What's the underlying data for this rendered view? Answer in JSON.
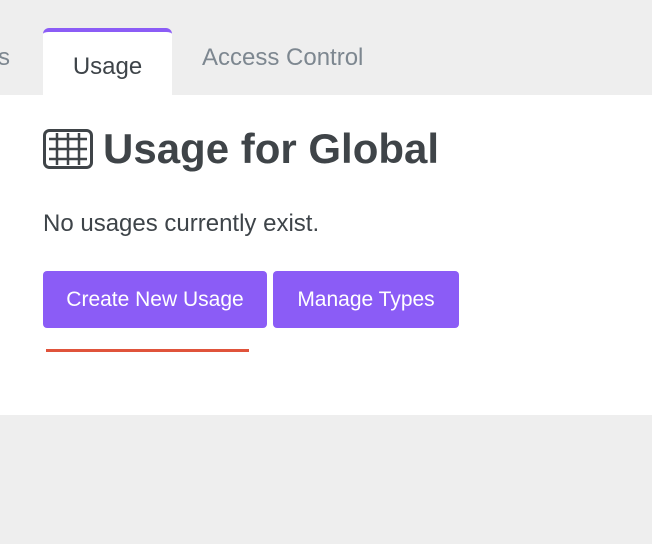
{
  "tabs": {
    "clipped_label": "s",
    "active_label": "Usage",
    "access_control_label": "Access Control"
  },
  "page": {
    "heading_icon": "abacus-icon",
    "title": "Usage for Global",
    "empty_message": "No usages currently exist."
  },
  "actions": {
    "create_label": "Create New Usage",
    "manage_label": "Manage Types"
  },
  "colors": {
    "accent": "#8b5cf6",
    "underline": "#e0533b",
    "text": "#3e4449",
    "muted": "#7d8790",
    "background": "#eeeeee",
    "panel": "#ffffff"
  }
}
